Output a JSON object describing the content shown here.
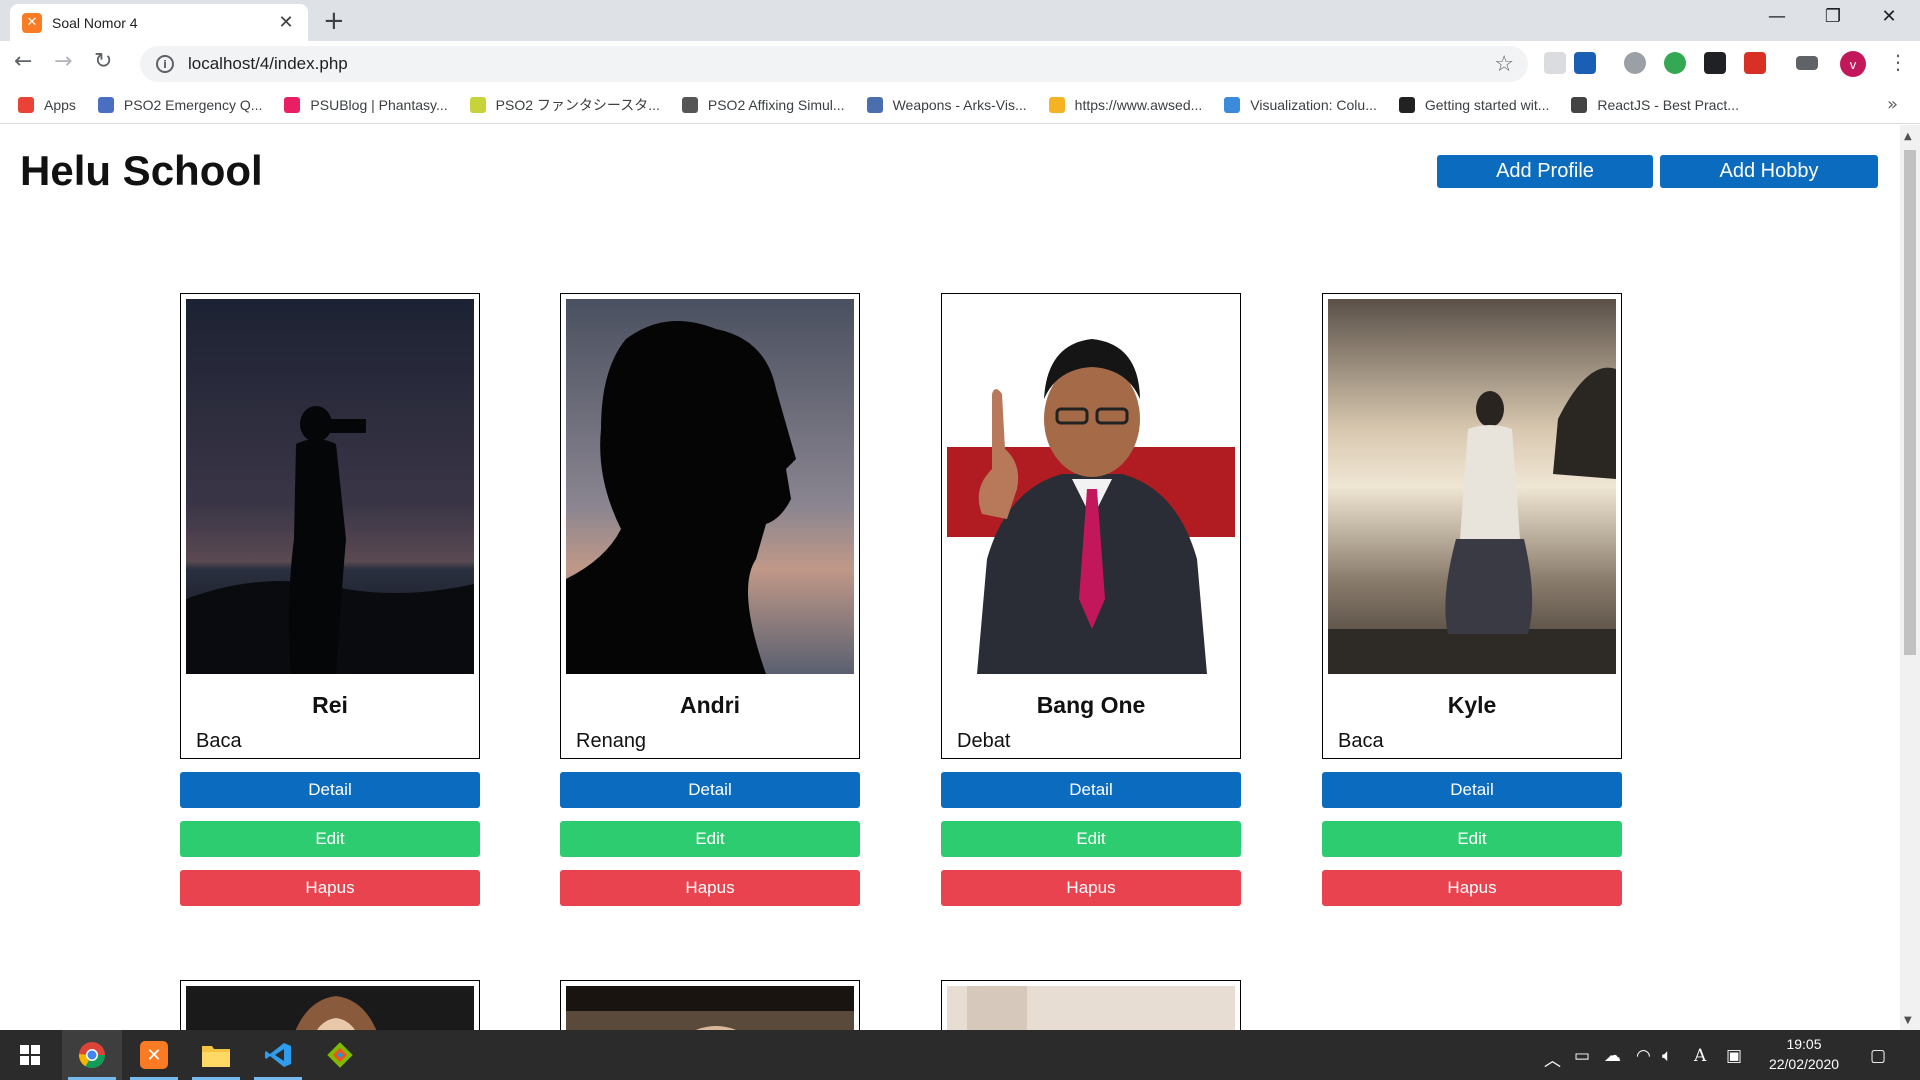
{
  "browser": {
    "tab_title": "Soal Nomor 4",
    "tab_close": "✕",
    "new_tab": "+",
    "url": "localhost/4/index.php",
    "avatar_letter": "v",
    "window_controls": {
      "minimize": "—",
      "maximize": "❐",
      "close": "✕"
    }
  },
  "bookmarks": [
    {
      "label": "Apps",
      "icon_color": "#ea4335"
    },
    {
      "label": "PSO2 Emergency Q...",
      "icon_color": "#4a6fc1"
    },
    {
      "label": "PSUBlog | Phantasy...",
      "icon_color": "#e91e63"
    },
    {
      "label": "PSO2 ファンタシースタ...",
      "icon_color": "#c6d33a"
    },
    {
      "label": "PSO2 Affixing Simul...",
      "icon_color": "#555555"
    },
    {
      "label": "Weapons - Arks-Vis...",
      "icon_color": "#4b6eaf"
    },
    {
      "label": "https://www.awsed...",
      "icon_color": "#f5b324"
    },
    {
      "label": "Visualization: Colu...",
      "icon_color": "#3c8bda"
    },
    {
      "label": "Getting started wit...",
      "icon_color": "#222222"
    },
    {
      "label": "ReactJS - Best Pract...",
      "icon_color": "#444444"
    }
  ],
  "page": {
    "title": "Helu School",
    "add_profile": "Add Profile",
    "add_hobby": "Add Hobby",
    "accent": "#0b6bbf",
    "cards": [
      {
        "name": "Rei",
        "hobby": "Baca",
        "detail": "Detail",
        "edit": "Edit",
        "hapus": "Hapus"
      },
      {
        "name": "Andri",
        "hobby": "Renang",
        "detail": "Detail",
        "edit": "Edit",
        "hapus": "Hapus"
      },
      {
        "name": "Bang One",
        "hobby": "Debat",
        "detail": "Detail",
        "edit": "Edit",
        "hapus": "Hapus"
      },
      {
        "name": "Kyle",
        "hobby": "Baca",
        "detail": "Detail",
        "edit": "Edit",
        "hapus": "Hapus"
      }
    ]
  },
  "taskbar": {
    "time": "19:05",
    "date": "22/02/2020",
    "apps": [
      "windows-start-icon",
      "chrome-icon",
      "xampp-icon",
      "file-explorer-icon",
      "vscode-icon",
      "git-icon"
    ]
  }
}
